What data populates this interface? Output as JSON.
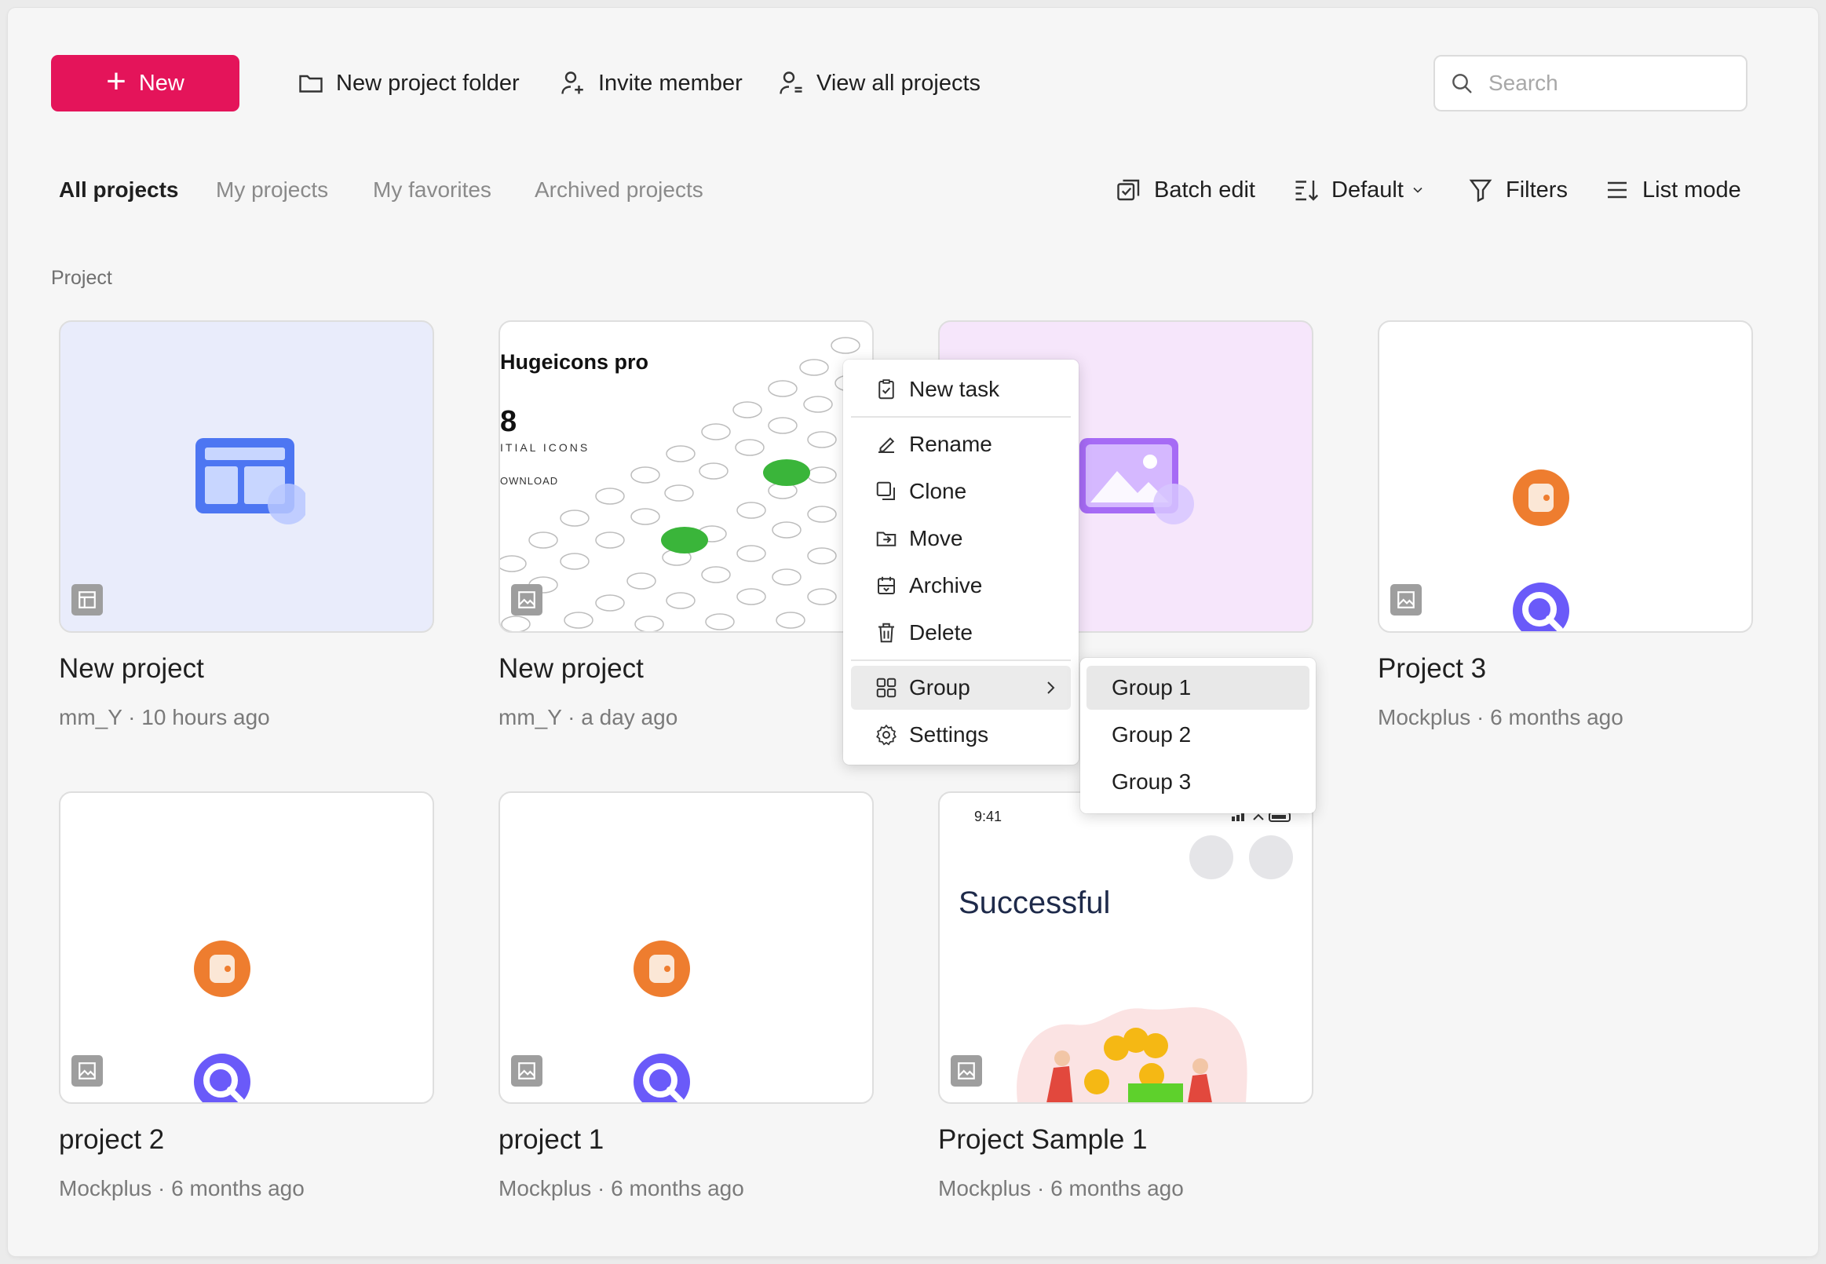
{
  "toolbar": {
    "new_label": "New",
    "new_folder_label": "New project folder",
    "invite_label": "Invite member",
    "view_all_label": "View all projects",
    "search_placeholder": "Search",
    "search_value": ""
  },
  "tabs": [
    {
      "label": "All projects",
      "active": true
    },
    {
      "label": "My projects",
      "active": false
    },
    {
      "label": "My favorites",
      "active": false
    },
    {
      "label": "Archived projects",
      "active": false
    }
  ],
  "actions": {
    "batch_edit": "Batch edit",
    "sort": "Default",
    "filters": "Filters",
    "list_mode": "List mode"
  },
  "section_label": "Project",
  "projects": [
    {
      "title": "New project",
      "meta": "mm_Y · 10 hours ago"
    },
    {
      "title": "New project",
      "meta": "mm_Y · a day ago",
      "thumb_title": "Hugeicons pro",
      "thumb_big": "8",
      "thumb_l1": "ITIAL ICONS",
      "thumb_l2": "OWNLOAD"
    },
    {
      "title": "",
      "meta": ""
    },
    {
      "title": "Project 3",
      "meta": "Mockplus · 6 months ago"
    },
    {
      "title": "project 2",
      "meta": "Mockplus · 6 months ago"
    },
    {
      "title": "project 1",
      "meta": "Mockplus · 6 months ago"
    },
    {
      "title": "Project Sample 1",
      "meta": "Mockplus · 6 months ago",
      "thumb_time": "9:41",
      "thumb_text": "Successful"
    }
  ],
  "context_menu": {
    "items": [
      "New task",
      "Rename",
      "Clone",
      "Move",
      "Archive",
      "Delete",
      "Group",
      "Settings"
    ],
    "highlighted": "Group"
  },
  "group_submenu": {
    "items": [
      "Group 1",
      "Group 2",
      "Group 3"
    ],
    "highlighted": "Group 1"
  },
  "colors": {
    "accent": "#e4145a",
    "card_blue_bg": "#e9ecfb",
    "card_pink_bg": "#f6e6fb",
    "orange_icon": "#ee7d2f",
    "purple_icon": "#6a5af9",
    "green_key": "#3ab53a"
  }
}
